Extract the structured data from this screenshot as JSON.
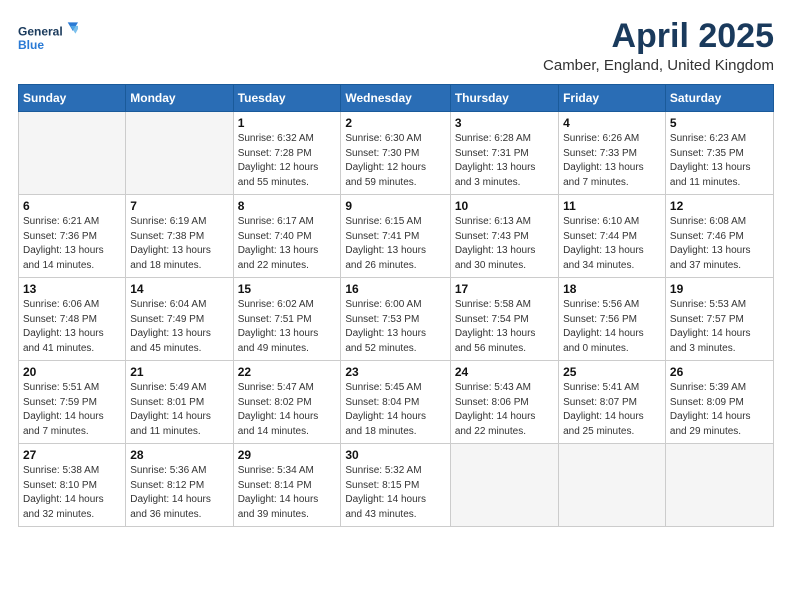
{
  "header": {
    "logo_line1": "General",
    "logo_line2": "Blue",
    "title": "April 2025",
    "subtitle": "Camber, England, United Kingdom"
  },
  "days_of_week": [
    "Sunday",
    "Monday",
    "Tuesday",
    "Wednesday",
    "Thursday",
    "Friday",
    "Saturday"
  ],
  "weeks": [
    [
      {
        "day": "",
        "detail": ""
      },
      {
        "day": "",
        "detail": ""
      },
      {
        "day": "1",
        "detail": "Sunrise: 6:32 AM\nSunset: 7:28 PM\nDaylight: 12 hours\nand 55 minutes."
      },
      {
        "day": "2",
        "detail": "Sunrise: 6:30 AM\nSunset: 7:30 PM\nDaylight: 12 hours\nand 59 minutes."
      },
      {
        "day": "3",
        "detail": "Sunrise: 6:28 AM\nSunset: 7:31 PM\nDaylight: 13 hours\nand 3 minutes."
      },
      {
        "day": "4",
        "detail": "Sunrise: 6:26 AM\nSunset: 7:33 PM\nDaylight: 13 hours\nand 7 minutes."
      },
      {
        "day": "5",
        "detail": "Sunrise: 6:23 AM\nSunset: 7:35 PM\nDaylight: 13 hours\nand 11 minutes."
      }
    ],
    [
      {
        "day": "6",
        "detail": "Sunrise: 6:21 AM\nSunset: 7:36 PM\nDaylight: 13 hours\nand 14 minutes."
      },
      {
        "day": "7",
        "detail": "Sunrise: 6:19 AM\nSunset: 7:38 PM\nDaylight: 13 hours\nand 18 minutes."
      },
      {
        "day": "8",
        "detail": "Sunrise: 6:17 AM\nSunset: 7:40 PM\nDaylight: 13 hours\nand 22 minutes."
      },
      {
        "day": "9",
        "detail": "Sunrise: 6:15 AM\nSunset: 7:41 PM\nDaylight: 13 hours\nand 26 minutes."
      },
      {
        "day": "10",
        "detail": "Sunrise: 6:13 AM\nSunset: 7:43 PM\nDaylight: 13 hours\nand 30 minutes."
      },
      {
        "day": "11",
        "detail": "Sunrise: 6:10 AM\nSunset: 7:44 PM\nDaylight: 13 hours\nand 34 minutes."
      },
      {
        "day": "12",
        "detail": "Sunrise: 6:08 AM\nSunset: 7:46 PM\nDaylight: 13 hours\nand 37 minutes."
      }
    ],
    [
      {
        "day": "13",
        "detail": "Sunrise: 6:06 AM\nSunset: 7:48 PM\nDaylight: 13 hours\nand 41 minutes."
      },
      {
        "day": "14",
        "detail": "Sunrise: 6:04 AM\nSunset: 7:49 PM\nDaylight: 13 hours\nand 45 minutes."
      },
      {
        "day": "15",
        "detail": "Sunrise: 6:02 AM\nSunset: 7:51 PM\nDaylight: 13 hours\nand 49 minutes."
      },
      {
        "day": "16",
        "detail": "Sunrise: 6:00 AM\nSunset: 7:53 PM\nDaylight: 13 hours\nand 52 minutes."
      },
      {
        "day": "17",
        "detail": "Sunrise: 5:58 AM\nSunset: 7:54 PM\nDaylight: 13 hours\nand 56 minutes."
      },
      {
        "day": "18",
        "detail": "Sunrise: 5:56 AM\nSunset: 7:56 PM\nDaylight: 14 hours\nand 0 minutes."
      },
      {
        "day": "19",
        "detail": "Sunrise: 5:53 AM\nSunset: 7:57 PM\nDaylight: 14 hours\nand 3 minutes."
      }
    ],
    [
      {
        "day": "20",
        "detail": "Sunrise: 5:51 AM\nSunset: 7:59 PM\nDaylight: 14 hours\nand 7 minutes."
      },
      {
        "day": "21",
        "detail": "Sunrise: 5:49 AM\nSunset: 8:01 PM\nDaylight: 14 hours\nand 11 minutes."
      },
      {
        "day": "22",
        "detail": "Sunrise: 5:47 AM\nSunset: 8:02 PM\nDaylight: 14 hours\nand 14 minutes."
      },
      {
        "day": "23",
        "detail": "Sunrise: 5:45 AM\nSunset: 8:04 PM\nDaylight: 14 hours\nand 18 minutes."
      },
      {
        "day": "24",
        "detail": "Sunrise: 5:43 AM\nSunset: 8:06 PM\nDaylight: 14 hours\nand 22 minutes."
      },
      {
        "day": "25",
        "detail": "Sunrise: 5:41 AM\nSunset: 8:07 PM\nDaylight: 14 hours\nand 25 minutes."
      },
      {
        "day": "26",
        "detail": "Sunrise: 5:39 AM\nSunset: 8:09 PM\nDaylight: 14 hours\nand 29 minutes."
      }
    ],
    [
      {
        "day": "27",
        "detail": "Sunrise: 5:38 AM\nSunset: 8:10 PM\nDaylight: 14 hours\nand 32 minutes."
      },
      {
        "day": "28",
        "detail": "Sunrise: 5:36 AM\nSunset: 8:12 PM\nDaylight: 14 hours\nand 36 minutes."
      },
      {
        "day": "29",
        "detail": "Sunrise: 5:34 AM\nSunset: 8:14 PM\nDaylight: 14 hours\nand 39 minutes."
      },
      {
        "day": "30",
        "detail": "Sunrise: 5:32 AM\nSunset: 8:15 PM\nDaylight: 14 hours\nand 43 minutes."
      },
      {
        "day": "",
        "detail": ""
      },
      {
        "day": "",
        "detail": ""
      },
      {
        "day": "",
        "detail": ""
      }
    ]
  ]
}
